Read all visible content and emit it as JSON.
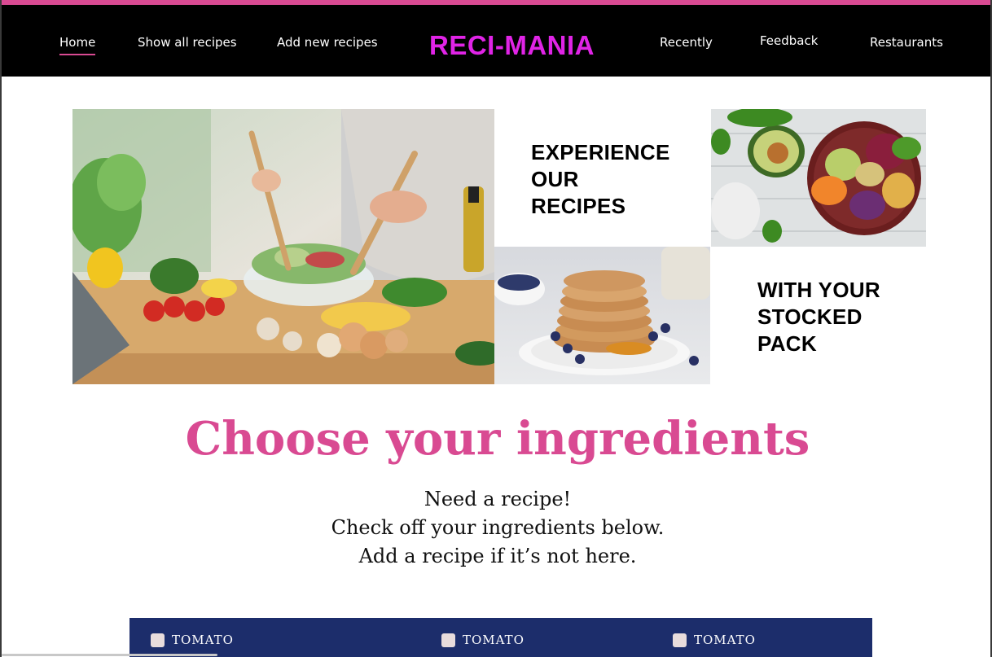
{
  "brand": {
    "name": "RECI-MANIA",
    "color": "#e024e6"
  },
  "nav": {
    "items": [
      {
        "label": "Home",
        "active": true
      },
      {
        "label": "Show all recipes"
      },
      {
        "label": "Add new recipes"
      },
      {
        "label": "Recently"
      },
      {
        "label": "Feedback"
      },
      {
        "label": "Restaurants"
      }
    ]
  },
  "hero": {
    "tagline_1": [
      "EXPERIENCE",
      "OUR",
      "RECIPES"
    ],
    "tagline_2": [
      "WITH YOUR",
      "STOCKED",
      "PACK"
    ],
    "photos": [
      "salad-preparation-photo",
      "vegetable-bowl-photo",
      "pancake-stack-photo"
    ]
  },
  "ingredients_section": {
    "title": "Choose your ingredients",
    "intro": [
      "Need a recipe!",
      "Check off your ingredients below.",
      "Add a recipe if it’s not here."
    ],
    "items": [
      {
        "label": "TOMATO",
        "checked": false
      },
      {
        "label": "TOMATO",
        "checked": false
      },
      {
        "label": "TOMATO",
        "checked": false
      }
    ]
  },
  "colors": {
    "accent": "#d94a92",
    "navbar": "#000000",
    "panel": "#1c2d6b"
  }
}
